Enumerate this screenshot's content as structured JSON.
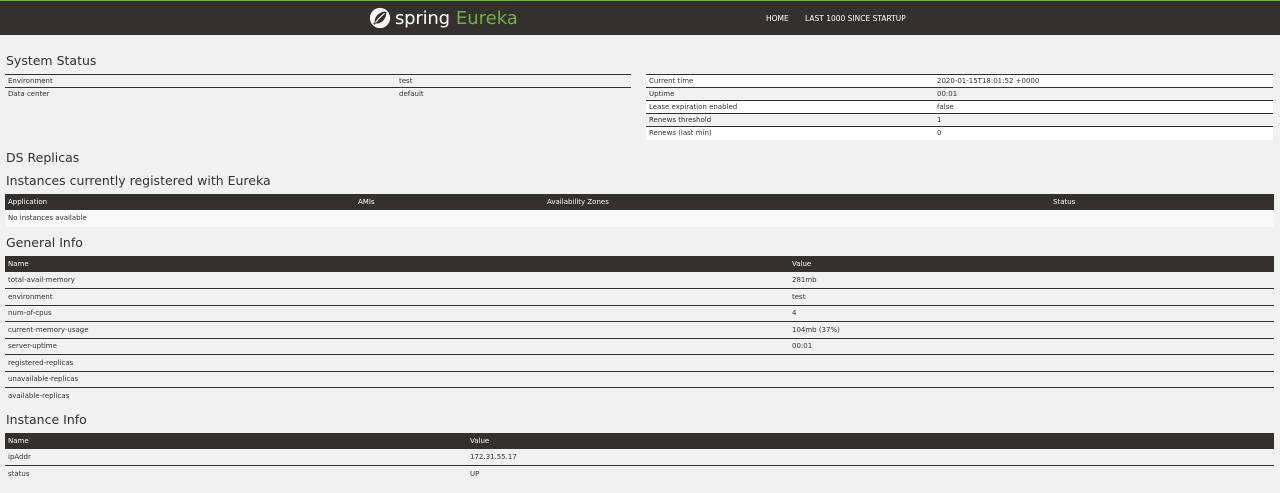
{
  "nav": {
    "brand_spring": "spring",
    "brand_eureka": "Eureka",
    "home": "HOME",
    "last1000": "LAST 1000 SINCE STARTUP"
  },
  "system_status": {
    "title": "System Status",
    "left": [
      {
        "label": "Environment",
        "value": "test"
      },
      {
        "label": "Data center",
        "value": "default"
      }
    ],
    "right": [
      {
        "label": "Current time",
        "value": "2020-01-15T18:01:52 +0000"
      },
      {
        "label": "Uptime",
        "value": "00:01"
      },
      {
        "label": "Lease expiration enabled",
        "value": "false"
      },
      {
        "label": "Renews threshold",
        "value": "1"
      },
      {
        "label": "Renews (last min)",
        "value": "0"
      }
    ]
  },
  "ds_replicas": {
    "title": "DS Replicas"
  },
  "instances": {
    "title": "Instances currently registered with Eureka",
    "headers": [
      "Application",
      "AMIs",
      "Availability Zones",
      "Status"
    ],
    "empty": "No instances available"
  },
  "general_info": {
    "title": "General Info",
    "headers": [
      "Name",
      "Value"
    ],
    "rows": [
      {
        "name": "total-avail-memory",
        "value": "281mb"
      },
      {
        "name": "environment",
        "value": "test"
      },
      {
        "name": "num-of-cpus",
        "value": "4"
      },
      {
        "name": "current-memory-usage",
        "value": "104mb (37%)"
      },
      {
        "name": "server-uptime",
        "value": "00:01"
      },
      {
        "name": "registered-replicas",
        "value": ""
      },
      {
        "name": "unavailable-replicas",
        "value": ""
      },
      {
        "name": "available-replicas",
        "value": ""
      }
    ]
  },
  "instance_info": {
    "title": "Instance Info",
    "headers": [
      "Name",
      "Value"
    ],
    "rows": [
      {
        "name": "ipAddr",
        "value": "172.31.55.17"
      },
      {
        "name": "status",
        "value": "UP"
      }
    ]
  }
}
